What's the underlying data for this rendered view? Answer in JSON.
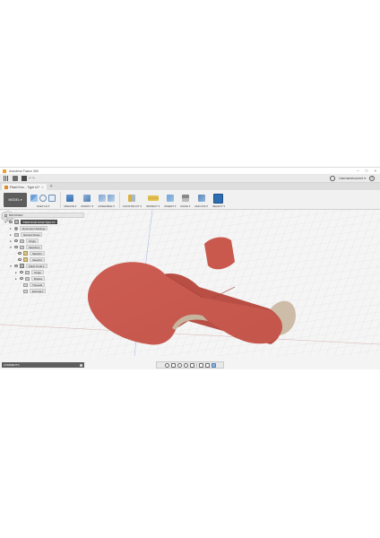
{
  "window": {
    "title": "Autodesk Fusion 360",
    "controls": [
      "–",
      "□",
      "×"
    ]
  },
  "quick_access": {
    "undo_redo_label": "↶ ↷",
    "user_name": "Usernamecurrent ▾",
    "help_label": "?"
  },
  "tabs": [
    {
      "label": "Flash Kno... Type c1*",
      "close": "×"
    }
  ],
  "tab_add": "+",
  "toolbar": {
    "workspace_label": "MODEL ▾",
    "groups": [
      {
        "label": "SKETCH ▾"
      },
      {
        "label": "CREATE ▾"
      },
      {
        "label": "MODIFY ▾"
      },
      {
        "label": "ASSEMBLE ▾"
      },
      {
        "label": "CONSTRUCT ▾"
      },
      {
        "label": "INSPECT ▾"
      },
      {
        "label": "INSERT ▾"
      },
      {
        "label": "MAKE ▾"
      },
      {
        "label": "ADD-INS ▾"
      },
      {
        "label": "SELECT ▾"
      }
    ]
  },
  "browser": {
    "header": "BROWSER",
    "items": [
      {
        "label": "Flash Knob Arrow Type c1"
      },
      {
        "label": "Document Settings"
      },
      {
        "label": "Named Views"
      },
      {
        "label": "Origin"
      },
      {
        "label": "Sketches"
      },
      {
        "label": "Sketch1"
      },
      {
        "label": "Sketch2"
      },
      {
        "label": "Flash Knob:1"
      },
      {
        "label": "Origin"
      },
      {
        "label": "Bodies"
      },
      {
        "label": "Thread1"
      },
      {
        "label": "Extrude1"
      }
    ]
  },
  "comments": {
    "label": "COMMENTS"
  },
  "colors": {
    "part_face": "#c8594e",
    "part_side": "#b64c43",
    "part_wall": "#c9b9a6",
    "select_accent": "#2f6db3"
  }
}
